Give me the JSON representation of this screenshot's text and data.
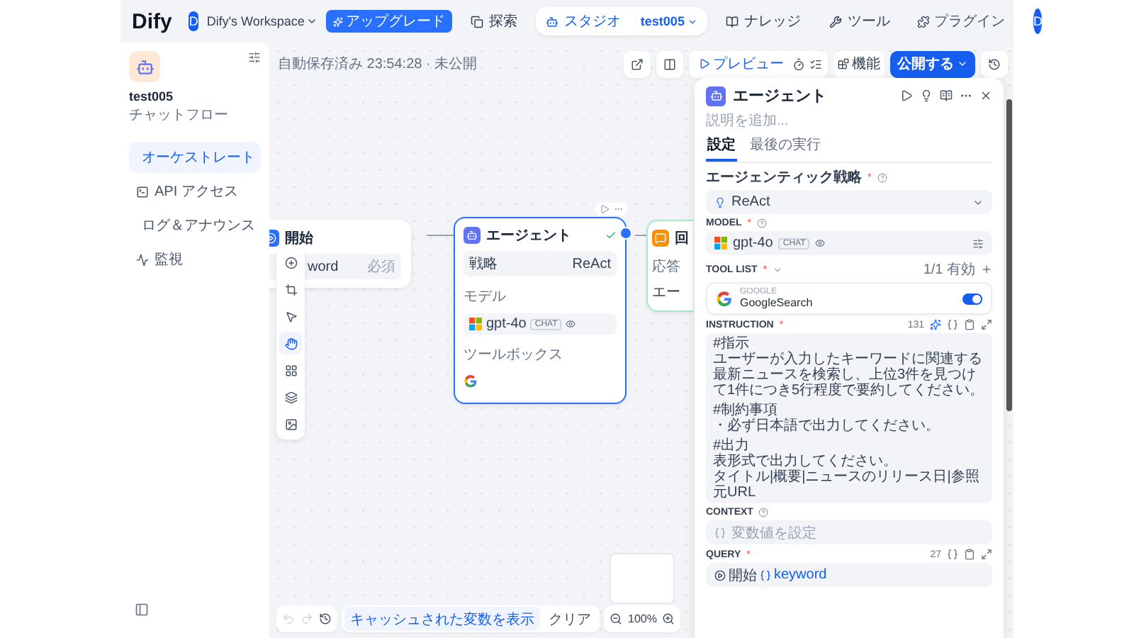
{
  "header": {
    "logo": "Dify",
    "workspace": {
      "initial": "D",
      "name": "Dify's Workspace"
    },
    "upgrade": "アップグレード",
    "nav": [
      {
        "label": "探索",
        "selected": false
      },
      {
        "label": "スタジオ",
        "selected": true,
        "crumb": "test005"
      },
      {
        "label": "ナレッジ",
        "selected": false
      },
      {
        "label": "ツール",
        "selected": false
      }
    ],
    "plugins": "プラグイン",
    "avatar": "D"
  },
  "sidebar": {
    "app_name": "test005",
    "app_type": "チャットフロー",
    "items": [
      {
        "label": "オーケストレート",
        "selected": true
      },
      {
        "label": "API アクセス",
        "selected": false
      },
      {
        "label": "ログ＆アナウンス",
        "selected": false
      },
      {
        "label": "監視",
        "selected": false
      }
    ]
  },
  "canvas": {
    "save_status": "自動保存済み 23:54:28 · 未公開",
    "preview": "プレビュー",
    "features": "機能",
    "publish": "公開する",
    "nodes": [
      {
        "kind": "start",
        "title": "開始",
        "variable": "word",
        "required": "必須"
      },
      {
        "kind": "agent",
        "title": "エージェント",
        "selected": true,
        "strategy_label": "戦略",
        "strategy": "ReAct",
        "model_label": "モデル",
        "model": "gpt-4o",
        "model_mode": "CHAT",
        "tools_label": "ツールボックス"
      },
      {
        "kind": "answer",
        "title": "回",
        "label": "応答",
        "value": "エー"
      }
    ],
    "tools": [
      {
        "selected": false
      },
      {
        "selected": false
      },
      {
        "selected": false
      },
      {
        "selected": true
      },
      {
        "selected": false
      },
      {
        "selected": false
      },
      {
        "selected": false
      }
    ],
    "show_cache": "キャッシュされた変数を表示",
    "clear": "クリア",
    "zoom": "100%"
  },
  "panel": {
    "title": "エージェント",
    "description_placeholder": "説明を追加...",
    "tabs": [
      {
        "label": "設定",
        "selected": true
      },
      {
        "label": "最後の実行",
        "selected": false
      }
    ],
    "strategy": {
      "label": "エージェンティック戦略",
      "required": "*",
      "value": "ReAct"
    },
    "model": {
      "label": "MODEL",
      "required": "*",
      "value": "gpt-4o",
      "mode": "CHAT"
    },
    "tool_list": {
      "label": "TOOL LIST",
      "required": "*",
      "status": "1/1 有効",
      "tools": [
        {
          "provider": "GOOGLE",
          "name": "GoogleSearch",
          "on": true
        }
      ]
    },
    "instruction": {
      "label": "INSTRUCTION",
      "required": "*",
      "count": "131",
      "paragraphs": [
        [
          "#指示",
          "ユーザーが入力したキーワードに関連する最新ニュースを検索し、上位3件を見つけて1件につき5行程度で要約してください。"
        ],
        [
          "#制約事項",
          "・必ず日本語で出力してください。"
        ],
        [
          "#出力",
          "表形式で出力してください。",
          "タイトル|概要|ニュースのリリース日|参照元URL"
        ]
      ]
    },
    "context": {
      "label": "CONTEXT",
      "placeholder": "変数値を設定"
    },
    "query": {
      "label": "QUERY",
      "required": "*",
      "count": "27",
      "source": "開始",
      "variable": "keyword"
    }
  }
}
